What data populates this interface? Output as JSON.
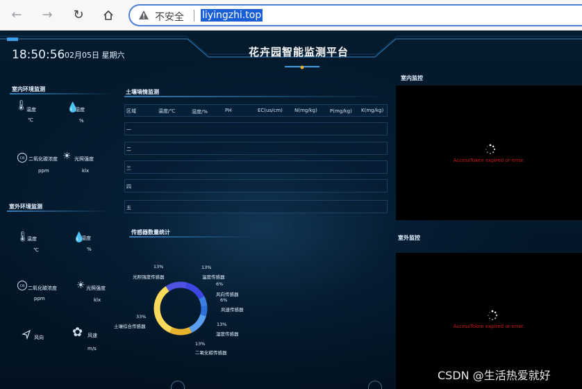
{
  "browser": {
    "insecure_label": "不安全",
    "url": "liyingzhi.top"
  },
  "header": {
    "time": "18:50:56",
    "date": "02月05日 星期六",
    "title": "花卉园智能监测平台"
  },
  "indoor_env": {
    "title": "室内环境监测",
    "sensors": [
      {
        "label": "温度",
        "unit": "℃",
        "icon": "thermometer-icon"
      },
      {
        "label": "湿度",
        "unit": "%",
        "icon": "humidity-icon"
      },
      {
        "label": "二氧化碳浓度",
        "unit": "ppm",
        "icon": "co2-icon"
      },
      {
        "label": "光照强度",
        "unit": "klx",
        "icon": "sun-icon"
      }
    ]
  },
  "outdoor_env": {
    "title": "室外环境监测",
    "sensors": [
      {
        "label": "温度",
        "unit": "℃",
        "icon": "thermometer-icon"
      },
      {
        "label": "湿度",
        "unit": "%",
        "icon": "humidity-icon"
      },
      {
        "label": "二氧化碳浓度",
        "unit": "ppm",
        "icon": "co2-icon"
      },
      {
        "label": "光照强度",
        "unit": "klx",
        "icon": "sun-icon"
      },
      {
        "label": "风向",
        "unit": "",
        "icon": "wind-direction-icon"
      },
      {
        "label": "风速",
        "unit": "m/s",
        "icon": "fan-icon"
      }
    ]
  },
  "soil": {
    "title": "土壤墒情监测",
    "columns": [
      "区域",
      "温度/℃",
      "湿度/%",
      "PH",
      "EC(us/cm)",
      "N(mg/kg)",
      "P(mg/kg)",
      "K(mg/kg)"
    ],
    "rows": [
      "一",
      "二",
      "三",
      "四",
      "五"
    ]
  },
  "sensor_stats": {
    "title": "传感器数量统计"
  },
  "chart_data": {
    "type": "pie",
    "title": "传感器数量统计",
    "donut": true,
    "slices": [
      {
        "name": "温度传感器",
        "value": 13,
        "label": "13%",
        "color": "#3d46e0"
      },
      {
        "name": "风向传感器",
        "value": 6,
        "label": "6%",
        "color": "#3b7fe6"
      },
      {
        "name": "风速传感器",
        "value": 6,
        "label": "6%",
        "color": "#2d6fd9"
      },
      {
        "name": "湿度传感器",
        "value": 13,
        "label": "13%",
        "color": "#5aa0f0"
      },
      {
        "name": "二氧化碳传感器",
        "value": 13,
        "label": "13%",
        "color": "#e9b22e"
      },
      {
        "name": "土壤综合传感器",
        "value": 33,
        "label": "33%",
        "color": "#f8d95a"
      },
      {
        "name": "光照强度传感器",
        "value": 13,
        "label": "13%",
        "color": "#4f52e0"
      }
    ]
  },
  "monitor": {
    "indoor_title": "室内监控",
    "outdoor_title": "室外监控",
    "error": "AccessToken expired or error."
  },
  "watermark": "CSDN @生活热爱就好",
  "colors": {
    "accent": "#4b7ed8",
    "error": "#d01818",
    "panel_bg": "#021220"
  }
}
